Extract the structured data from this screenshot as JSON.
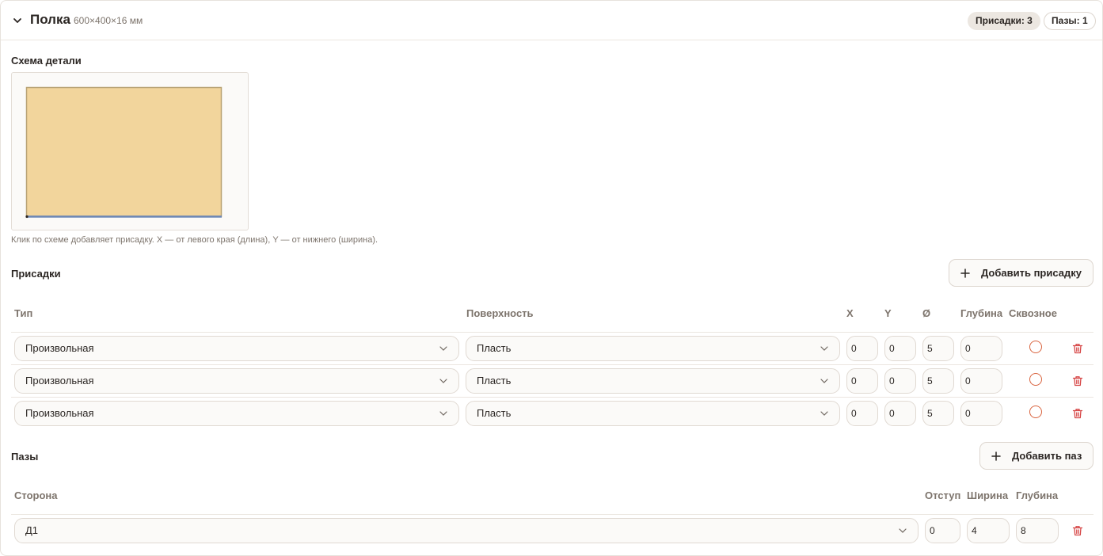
{
  "part": {
    "title": "Полка",
    "dims": "600×400×16 мм",
    "badge_drillings": "Присадки: 3",
    "badge_grooves": "Пазы: 1"
  },
  "scheme": {
    "title": "Схема детали",
    "hint": "Клик по схеме добавляет присадку. X — от левого края (длина), Y — от нижнего (ширина)."
  },
  "drillings": {
    "title": "Присадки",
    "add_label": "Добавить присадку",
    "columns": {
      "type": "Тип",
      "surface": "Поверхность",
      "x": "X",
      "y": "Y",
      "diameter": "Ø",
      "depth": "Глубина",
      "through": "Сквозное"
    },
    "rows": [
      {
        "type": "Произвольная",
        "surface": "Пласть",
        "x": "0",
        "y": "0",
        "d": "5",
        "depth": "0"
      },
      {
        "type": "Произвольная",
        "surface": "Пласть",
        "x": "0",
        "y": "0",
        "d": "5",
        "depth": "0"
      },
      {
        "type": "Произвольная",
        "surface": "Пласть",
        "x": "0",
        "y": "0",
        "d": "5",
        "depth": "0"
      }
    ]
  },
  "grooves": {
    "title": "Пазы",
    "add_label": "Добавить паз",
    "columns": {
      "side": "Сторона",
      "offset": "Отступ",
      "width": "Ширина",
      "depth": "Глубина"
    },
    "rows": [
      {
        "side": "Д1",
        "offset": "0",
        "width": "4",
        "depth": "8"
      }
    ]
  },
  "colors": {
    "panel_fill": "#f2d59c",
    "panel_stroke": "#b8a274",
    "groove_line": "#6b86b5",
    "accent": "#d9643f",
    "danger": "#d64545"
  }
}
